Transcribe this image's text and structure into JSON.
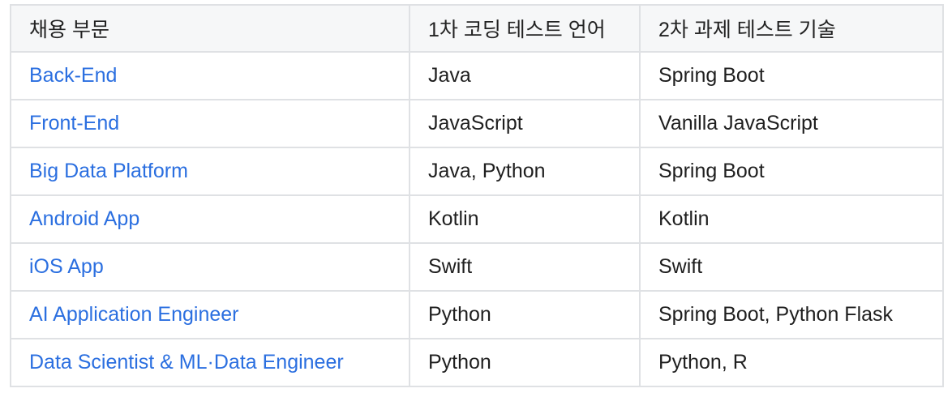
{
  "table": {
    "headers": [
      "채용 부문",
      "1차 코딩 테스트 언어",
      "2차 과제 테스트 기술"
    ],
    "rows": [
      {
        "position": "Back-End",
        "coding_language": "Java",
        "assignment_tech": "Spring Boot"
      },
      {
        "position": "Front-End",
        "coding_language": "JavaScript",
        "assignment_tech": "Vanilla JavaScript"
      },
      {
        "position": "Big Data Platform",
        "coding_language": "Java, Python",
        "assignment_tech": "Spring Boot"
      },
      {
        "position": "Android App",
        "coding_language": "Kotlin",
        "assignment_tech": "Kotlin"
      },
      {
        "position": "iOS App",
        "coding_language": "Swift",
        "assignment_tech": "Swift"
      },
      {
        "position": "AI Application Engineer",
        "coding_language": "Python",
        "assignment_tech": "Spring Boot, Python Flask"
      },
      {
        "position": "Data Scientist & ML·Data Engineer",
        "coding_language": "Python",
        "assignment_tech": "Python, R"
      }
    ]
  },
  "colors": {
    "link": "#2b6fe0",
    "border": "#dfe1e4",
    "header_bg": "#f6f7f8",
    "text": "#1f1f1f"
  }
}
